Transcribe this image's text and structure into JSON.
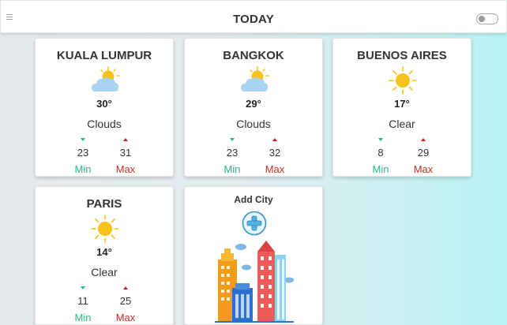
{
  "header": {
    "title": "TODAY"
  },
  "cities": [
    {
      "name": "KUALA LUMPUR",
      "temp": "30°",
      "description": "Clouds",
      "icon": "partly-cloudy-icon",
      "min": "23",
      "max": "31",
      "min_label": "Min",
      "max_label": "Max"
    },
    {
      "name": "BANGKOK",
      "temp": "29°",
      "description": "Clouds",
      "icon": "partly-cloudy-icon",
      "min": "23",
      "max": "32",
      "min_label": "Min",
      "max_label": "Max"
    },
    {
      "name": "BUENOS AIRES",
      "temp": "17°",
      "description": "Clear",
      "icon": "sun-icon",
      "min": "8",
      "max": "29",
      "min_label": "Min",
      "max_label": "Max"
    },
    {
      "name": "PARIS",
      "temp": "14°",
      "description": "Clear",
      "icon": "sun-icon",
      "min": "11",
      "max": "25",
      "min_label": "Min",
      "max_label": "Max"
    }
  ],
  "add_city": {
    "label": "Add City",
    "icon": "plus-circle-icon"
  },
  "colors": {
    "min": "#2bb58a",
    "max": "#c0332b",
    "sun": "#f8c21c",
    "cloud": "#a9d3f0"
  }
}
